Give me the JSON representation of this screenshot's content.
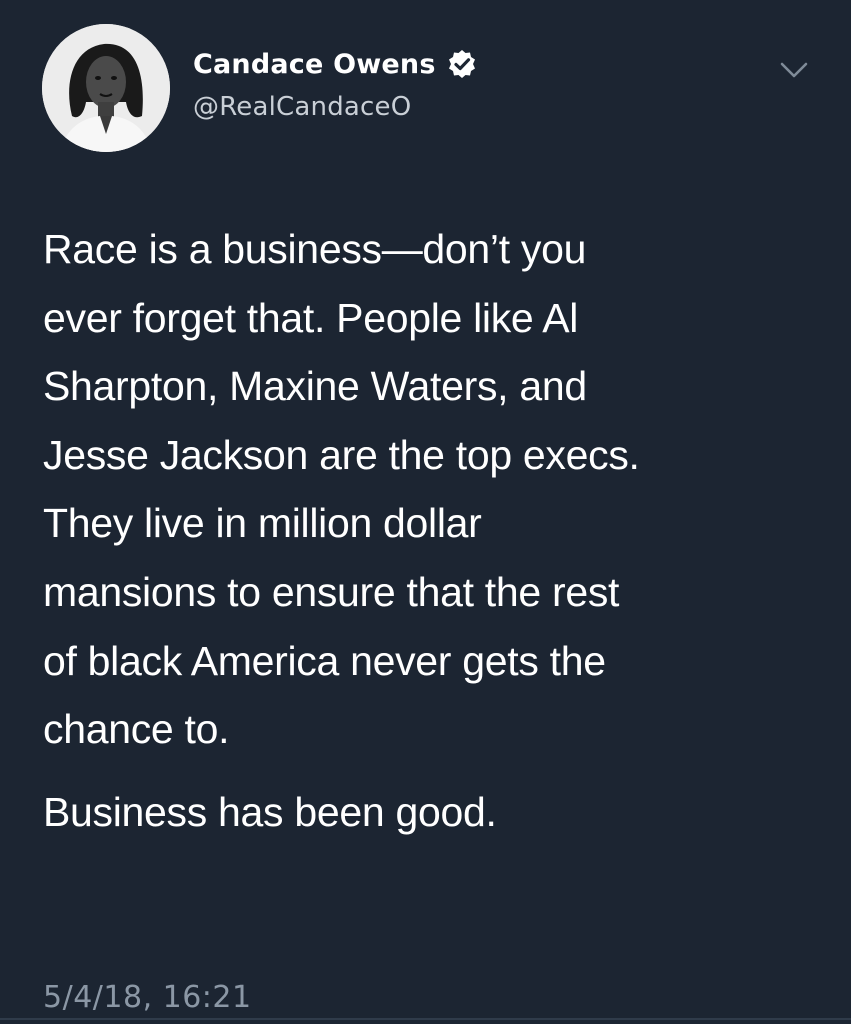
{
  "tweet": {
    "display_name": "Candace Owens",
    "handle": "@RealCandaceO",
    "verified_icon": "verified-badge-icon",
    "menu_icon": "chevron-down-icon",
    "lines": [
      "Race is a business—don’t you",
      "ever forget that. People like Al",
      "Sharpton, Maxine Waters, and",
      "Jesse Jackson are the top execs.",
      "They live in million dollar",
      "mansions to ensure that the rest",
      "of black America never gets the",
      "chance to."
    ],
    "closing_line": "Business has been good.",
    "timestamp": "5/4/18, 16:21"
  },
  "colors": {
    "background": "#1c2532",
    "text": "#ffffff",
    "handle": "#c9cfd6",
    "timestamp": "#8b97a5"
  }
}
